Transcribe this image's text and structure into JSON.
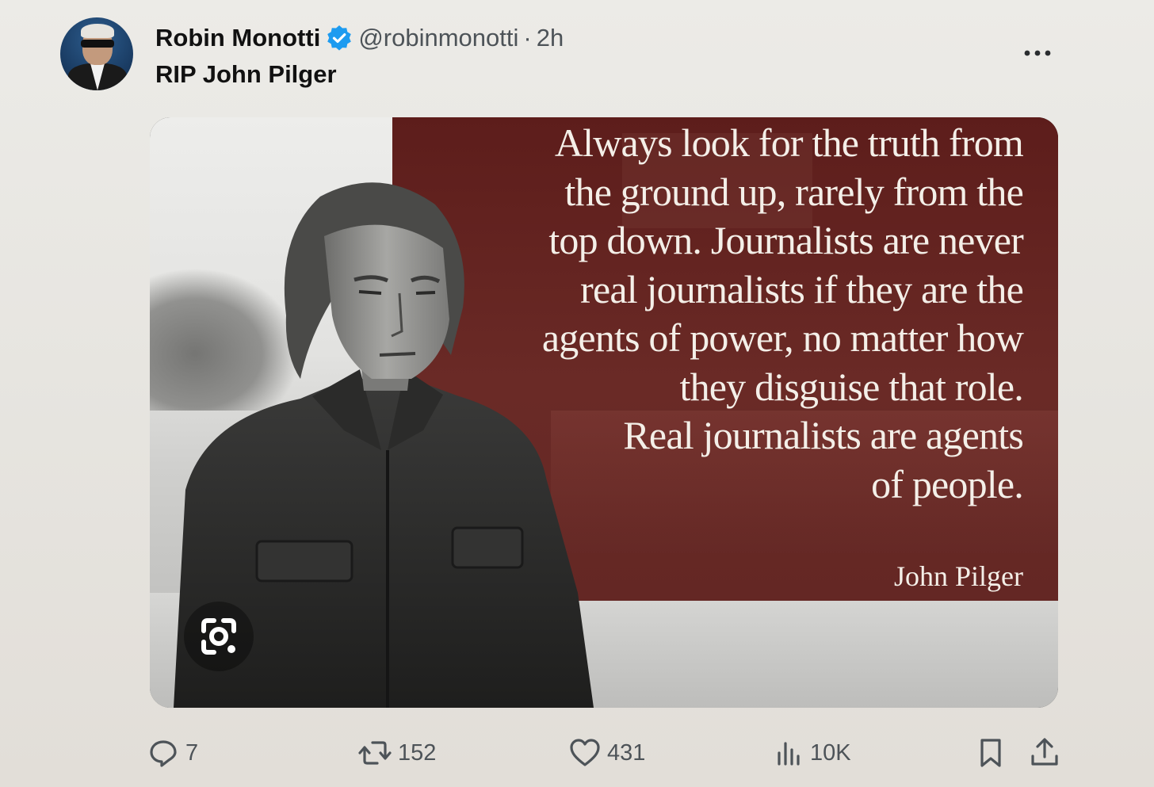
{
  "post": {
    "author": {
      "display_name": "Robin Monotti",
      "handle": "@robinmonotti",
      "time": "2h",
      "separator": "·",
      "verified": true,
      "avatar_icon": "avatar"
    },
    "text": "RIP John Pilger",
    "media": {
      "quote_lines": [
        "Always look for the truth from",
        "the ground up, rarely from the",
        "top down. Journalists are never",
        "real journalists if they are the",
        "agents of power, no matter how",
        "they disguise that role.",
        "Real journalists are agents",
        "of people."
      ],
      "attribution": "John Pilger",
      "panel_color": "#5d1d1b",
      "lens_icon": "visual-search-icon"
    },
    "metrics": {
      "replies": "7",
      "reposts": "152",
      "likes": "431",
      "views": "10K"
    }
  },
  "colors": {
    "verified_blue": "#1d9bf0",
    "text_primary": "#111111",
    "text_secondary": "#4d5358"
  }
}
